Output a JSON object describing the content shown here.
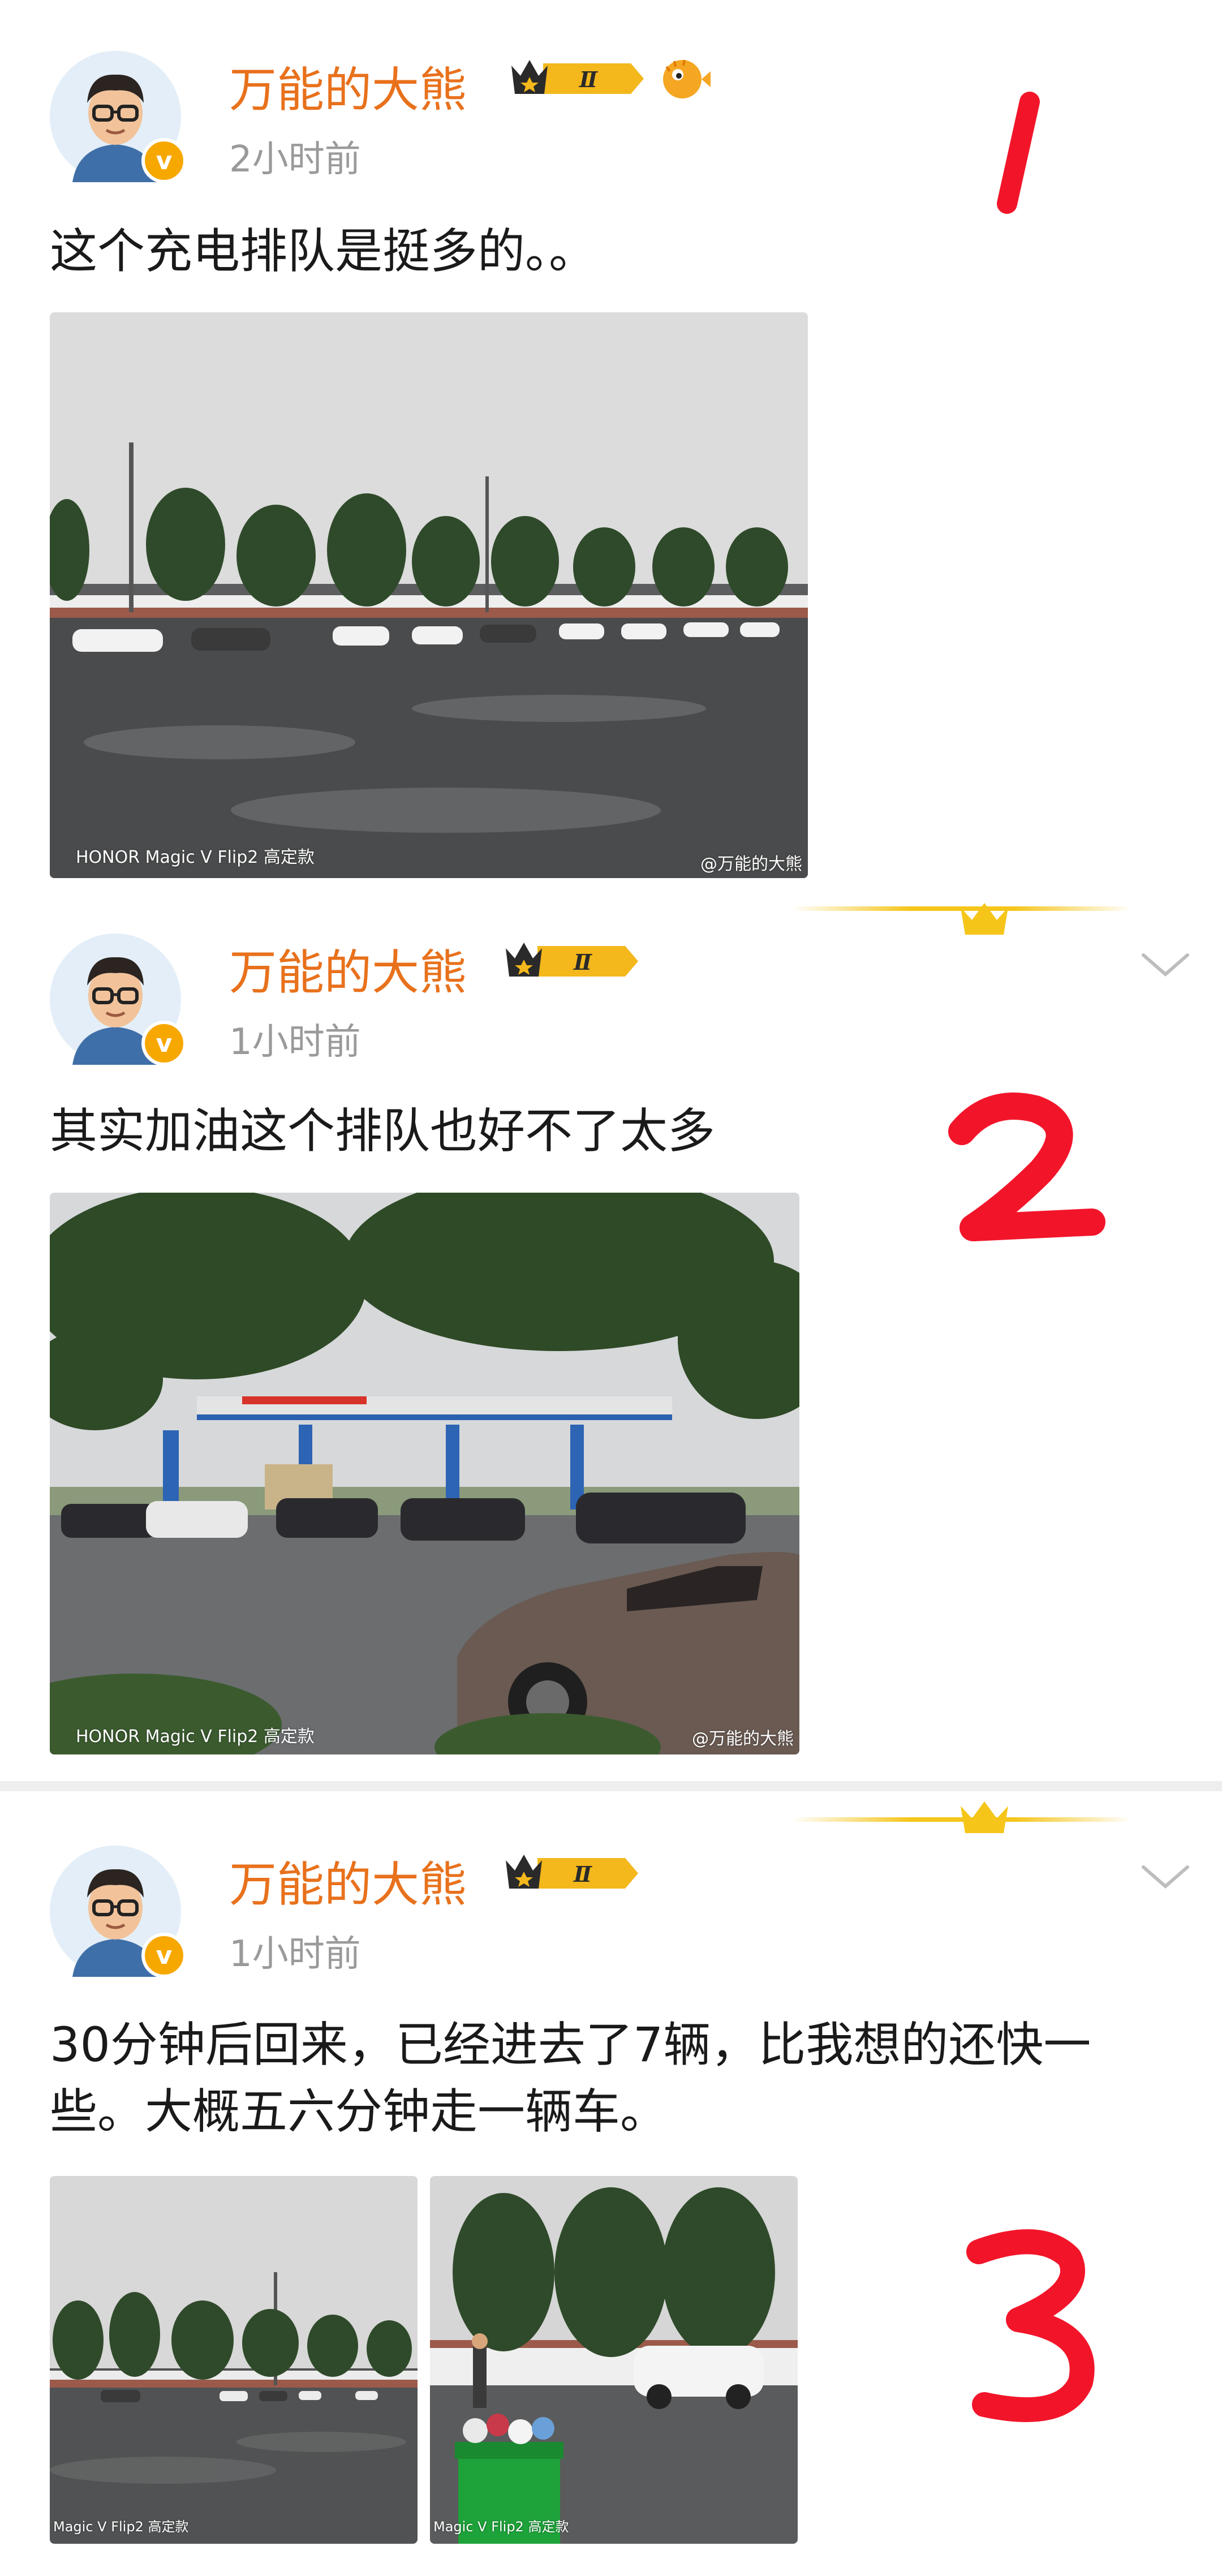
{
  "colors": {
    "username": "#e8711c",
    "time": "#9a9a9a",
    "annotation": "#f2152a",
    "accent_gold": "#f5c51a"
  },
  "posts": [
    {
      "username": "万能的大熊",
      "level_badge": "Ⅱ",
      "verified_icon": "v-badge-icon",
      "time": "2小时前",
      "text": "这个充电排队是挺多的。。",
      "watermark_left": "HONOR Magic V Flip2 高定款",
      "watermark_right": "@万能的大熊",
      "annotation": "1"
    },
    {
      "username": "万能的大熊",
      "level_badge": "Ⅱ",
      "verified_icon": "v-badge-icon",
      "time": "1小时前",
      "text": "其实加油这个排队也好不了太多",
      "watermark_left": "HONOR Magic V Flip2 高定款",
      "watermark_right": "@万能的大熊",
      "annotation": "2"
    },
    {
      "username": "万能的大熊",
      "level_badge": "Ⅱ",
      "verified_icon": "v-badge-icon",
      "time": "1小时前",
      "text_line1": "30分钟后回来，已经进去了7辆，比我想的还快一",
      "text_line2": "些。大概五六分钟走一辆车。",
      "watermark_left": "Magic V Flip2 高定款",
      "watermark_left2": "Magic V Flip2 高定款",
      "annotation": "3"
    }
  ]
}
